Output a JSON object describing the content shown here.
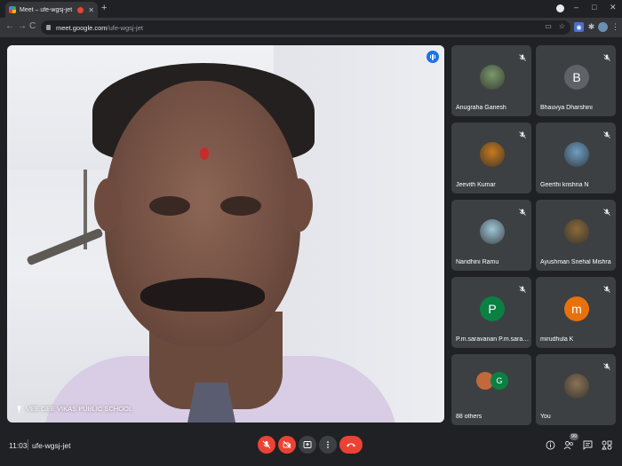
{
  "browser": {
    "tab_title": "Meet – ufe-wgsj-jet",
    "tab_close": "✕",
    "new_tab": "+",
    "url_host": "meet.google.com",
    "url_path": "/ufe-wgsj-jet",
    "back": "←",
    "forward": "→",
    "reload": "C",
    "minimize": "–",
    "maximize": "□",
    "close": "✕",
    "menu": "⋮"
  },
  "main_video": {
    "presenter_label": "VEE GEE VIKAS PUBLIC SCHOOL"
  },
  "participants": [
    {
      "name": "Anugraha Ganesh",
      "avatar_type": "photo",
      "avatar_color": "#7a9a6b",
      "muted": true
    },
    {
      "name": "Bhauvya Dharshini",
      "avatar_type": "letter",
      "initial": "B",
      "avatar_color": "#5f6368",
      "muted": true
    },
    {
      "name": "Jeevith Kumar",
      "avatar_type": "photo",
      "avatar_color": "#c77a1e",
      "muted": true
    },
    {
      "name": "Geerthi krishna N",
      "avatar_type": "photo",
      "avatar_color": "#6f9ec5",
      "muted": true
    },
    {
      "name": "Nandhini Ramu",
      "avatar_type": "photo",
      "avatar_color": "#9ec7d8",
      "muted": true
    },
    {
      "name": "Ayushman Snehal Mishra",
      "avatar_type": "photo",
      "avatar_color": "#8a6a3a",
      "muted": true
    },
    {
      "name": "P.m.saravanan P.m.saravanan",
      "avatar_type": "letter",
      "initial": "P",
      "avatar_color": "#0b8043",
      "muted": true
    },
    {
      "name": "mirudhula K",
      "avatar_type": "letter",
      "initial": "m",
      "avatar_color": "#e8710a",
      "muted": true
    },
    {
      "name": "88 others",
      "avatar_type": "group",
      "second_initial": "G",
      "avatar_color": "#0b8043",
      "muted": false
    },
    {
      "name": "You",
      "avatar_type": "photo",
      "avatar_color": "#8b7355",
      "muted": true
    }
  ],
  "bottom_bar": {
    "time": "11:03",
    "meeting_code": "ufe-wgsj-jet",
    "participant_count": "99"
  },
  "colors": {
    "background": "#202124",
    "tile": "#3c4043",
    "danger": "#ea4335",
    "accent": "#1a73e8"
  }
}
